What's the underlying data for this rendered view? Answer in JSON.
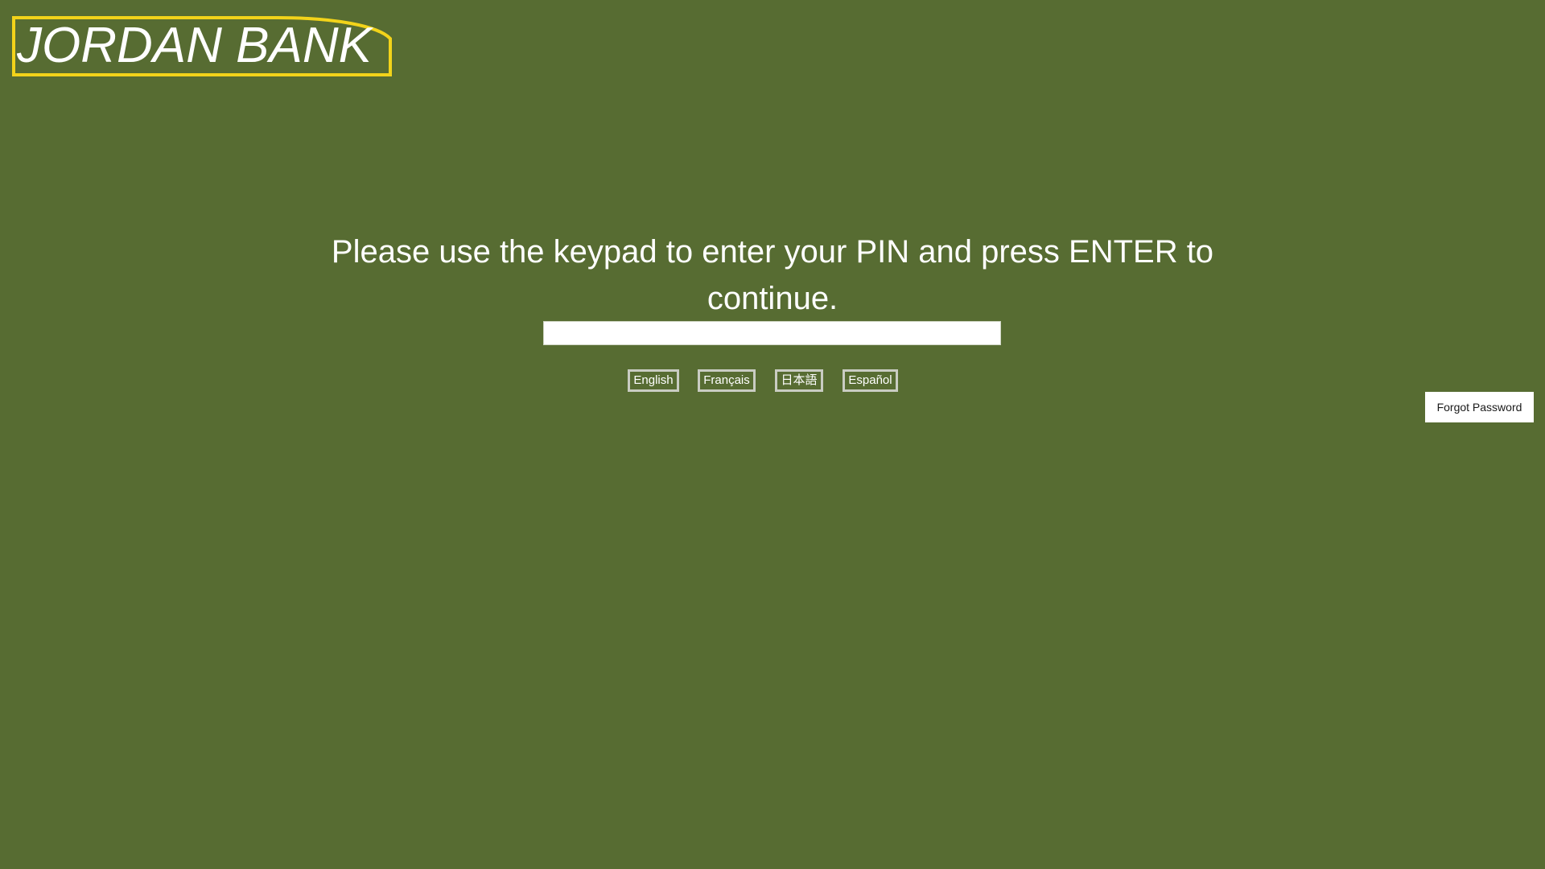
{
  "bank": {
    "name": "JORDAN BANK"
  },
  "prompt": {
    "text": "Please use the keypad to enter your PIN and press ENTER to continue."
  },
  "pin": {
    "value": "",
    "placeholder": ""
  },
  "languages": [
    {
      "label": "English"
    },
    {
      "label": "Français"
    },
    {
      "label": "日本語"
    },
    {
      "label": "Español"
    }
  ],
  "forgot_password": {
    "label": "Forgot Password"
  },
  "colors": {
    "background": "#576c32",
    "logo_border": "#f2d31a",
    "text": "#ffffff"
  }
}
